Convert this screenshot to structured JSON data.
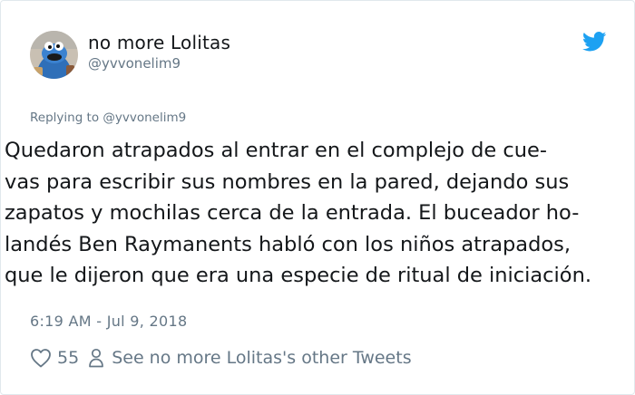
{
  "user": {
    "display_name": "no more Lolitas",
    "handle": "@yvvonelim9",
    "avatar_icon": "cookie-monster-avatar"
  },
  "brand": {
    "icon": "twitter-bird-icon",
    "color": "#1da1f2"
  },
  "reply": {
    "label": "Replying to @yvvonelim9"
  },
  "tweet": {
    "lines": [
      "Quedaron atrapados al entrar en el complejo de cue-",
      "vas para escribir sus nombres en la pared, dejando sus",
      "zapatos y mochilas cerca de la entrada. El buceador ho-",
      "landés Ben Raymanents habló con los niños atrapados,",
      "que le dijeron que era una especie de ritual de iniciación."
    ],
    "timestamp": "6:19 AM - Jul 9, 2018"
  },
  "actions": {
    "like_icon": "heart-icon",
    "like_count": "55",
    "profile_icon": "person-icon",
    "other_tweets_label": "See no more Lolitas's other Tweets"
  },
  "colors": {
    "text": "#14171a",
    "secondary": "#657786",
    "border": "#e1e8ed"
  }
}
